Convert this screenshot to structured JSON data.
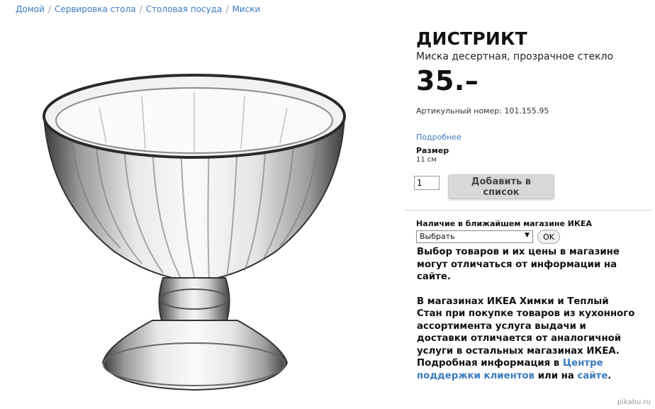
{
  "breadcrumb": [
    "Домой",
    "Сервировка стола",
    "Столовая посуда",
    "Миски"
  ],
  "breadcrumb_separator": "/",
  "product": {
    "title": "ДИСТРИКТ",
    "subtitle": "Миска десертная, прозрачное стекло",
    "price": "35.–",
    "article": "Артикульный номер: 101.155.95",
    "more_link": "Подробнее",
    "size_label": "Размер",
    "size_value": "11 см",
    "quantity": "1",
    "add_button": "Добавить в список"
  },
  "availability": {
    "label": "Наличие в ближайшем магазине ИКЕА",
    "select_value": "Выбрать",
    "ok_button": "OK"
  },
  "info": {
    "paragraph1": "Выбор товаров и их цены в магазине могут отличаться от информации на сайте.",
    "paragraph2_prefix": "В магазинах ИКЕА Химки и Теплый Стан при покупке товаров из кухонного ассортимента услуга выдачи и доставки отличается от аналогичной услуги в остальных магазинах ИКЕА. Подробная информация в ",
    "support_link": "Центре поддержки клиентов",
    "middle": " или на ",
    "site_link": "сайте",
    "suffix": "."
  },
  "watermark": "pikabu.ru",
  "colors": {
    "link": "#3a7bbf",
    "button_bg": "#d8d8d8"
  }
}
